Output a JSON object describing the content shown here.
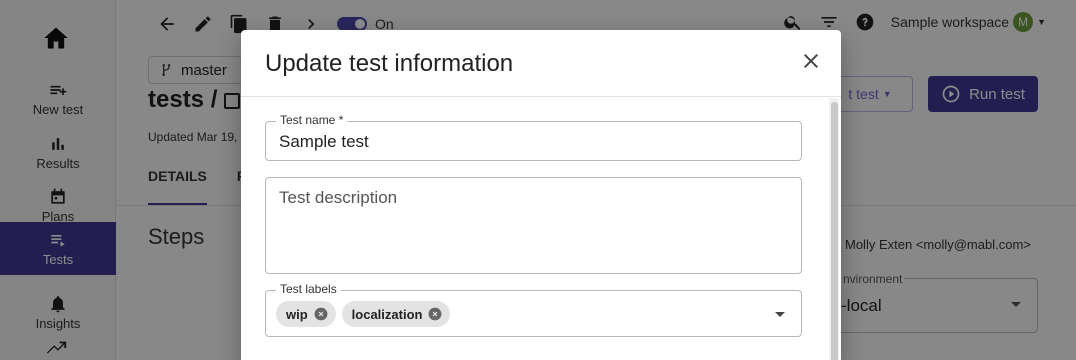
{
  "nav": {
    "items": [
      {
        "label": "New test"
      },
      {
        "label": "Results"
      },
      {
        "label": "Plans"
      },
      {
        "label": "Tests"
      },
      {
        "label": "Insights"
      }
    ]
  },
  "toolbar": {
    "toggle_label": "On"
  },
  "header": {
    "workspace": "Sample workspace",
    "avatar_initial": "M"
  },
  "page": {
    "branch": "master",
    "title": "tests / ",
    "updated": "Updated Mar 19,",
    "tabs": [
      "DETAILS",
      "RU"
    ],
    "steps_title": "Steps",
    "edit_button": "t test",
    "run_button": "Run test",
    "owner": "Molly Exten <molly@mabl.com>",
    "env_label": "nvironment",
    "env_value": "-local"
  },
  "modal": {
    "title": "Update test information",
    "name_label": "Test name *",
    "name_value": "Sample test",
    "description_placeholder": "Test description",
    "labels_label": "Test labels",
    "labels": [
      "wip",
      "localization"
    ]
  },
  "colors": {
    "primary": "#3f3a93",
    "avatar": "#6b9c3b"
  }
}
